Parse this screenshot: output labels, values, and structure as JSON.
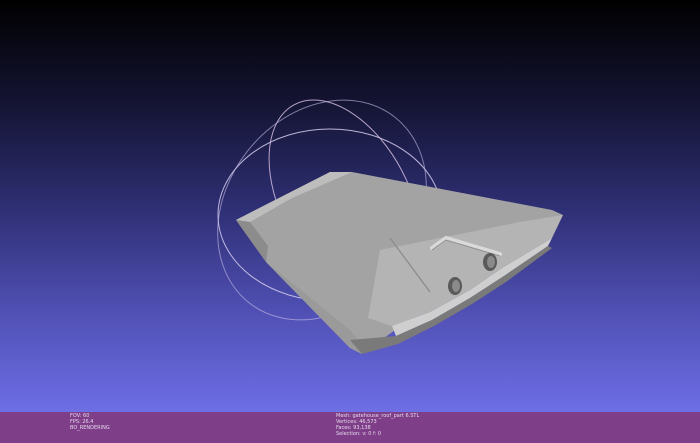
{
  "viewer": {
    "background_top": "#000000",
    "background_bottom": "#6e6ee6",
    "model_color": "#a6a6a6",
    "trackball_color": "#d8c8e8"
  },
  "status": {
    "background": "#7e3f88",
    "left_lines": [
      "FOV: 60",
      "FPS:  26.4",
      "BO_RENDERING"
    ],
    "right_lines": [
      "Mesh: gatehouse_roof_part 6.STL",
      "Vertices: 46,573",
      "Faces: 93,138",
      "Selection: v: 0 f: 0"
    ]
  }
}
